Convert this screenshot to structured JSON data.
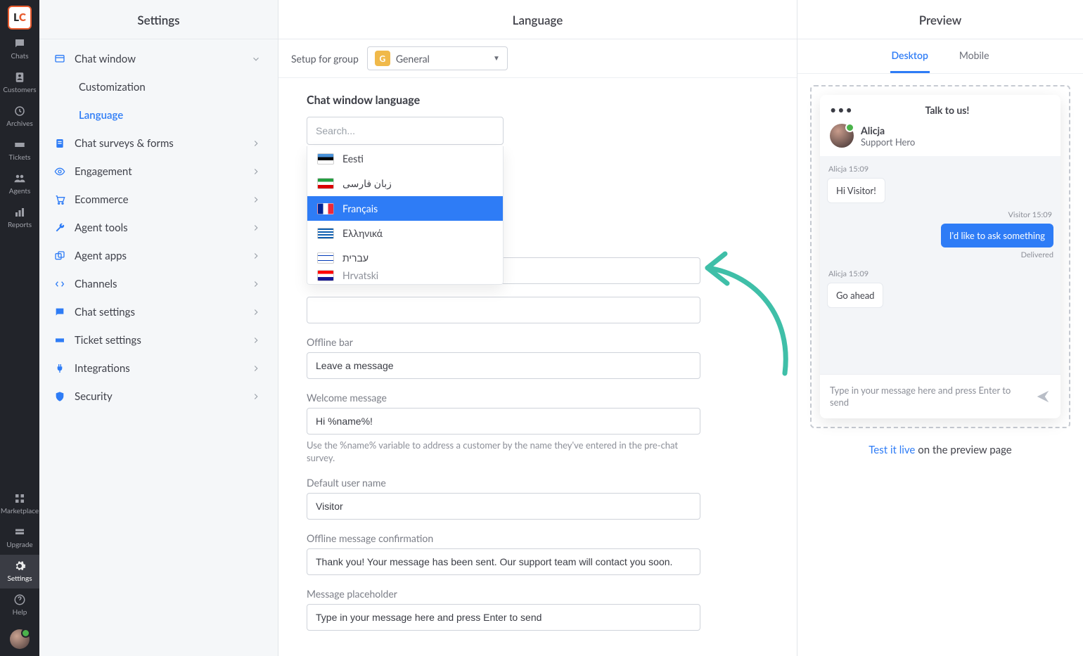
{
  "rail": {
    "items": [
      {
        "label": "Chats"
      },
      {
        "label": "Customers"
      },
      {
        "label": "Archives"
      },
      {
        "label": "Tickets"
      },
      {
        "label": "Agents"
      },
      {
        "label": "Reports"
      }
    ],
    "bottom": [
      {
        "label": "Marketplace"
      },
      {
        "label": "Upgrade"
      },
      {
        "label": "Settings"
      },
      {
        "label": "Help"
      }
    ]
  },
  "sidebar": {
    "title": "Settings",
    "chat_window": {
      "label": "Chat window",
      "sub": {
        "customization": "Customization",
        "language": "Language"
      }
    },
    "items": [
      {
        "label": "Chat surveys & forms"
      },
      {
        "label": "Engagement"
      },
      {
        "label": "Ecommerce"
      },
      {
        "label": "Agent tools"
      },
      {
        "label": "Agent apps"
      },
      {
        "label": "Channels"
      },
      {
        "label": "Chat settings"
      },
      {
        "label": "Ticket settings"
      },
      {
        "label": "Integrations"
      },
      {
        "label": "Security"
      }
    ]
  },
  "editor": {
    "title": "Language",
    "group_label": "Setup for group",
    "group_badge": "G",
    "group_value": "General",
    "section_title": "Chat window language",
    "search_placeholder": "Search...",
    "lang_options": [
      {
        "label": "Eesti"
      },
      {
        "label": "زبان فارسی"
      },
      {
        "label": "Français"
      },
      {
        "label": "Ελληνικά"
      },
      {
        "label": "עברית"
      },
      {
        "label": "Hrvatski"
      }
    ],
    "fields": {
      "offline_bar": {
        "label": "Offline bar",
        "value": "Leave a message"
      },
      "welcome": {
        "label": "Welcome message",
        "value": "Hi %name%!",
        "hint": "Use the %name% variable to address a customer by the name they've entered in the pre-chat survey."
      },
      "default_user": {
        "label": "Default user name",
        "value": "Visitor"
      },
      "offline_confirm": {
        "label": "Offline message confirmation",
        "value": "Thank you! Your message has been sent. Our support team will contact you soon."
      },
      "placeholder": {
        "label": "Message placeholder",
        "value": "Type in your message here and press Enter to send"
      }
    }
  },
  "preview": {
    "title": "Preview",
    "tabs": {
      "desktop": "Desktop",
      "mobile": "Mobile"
    },
    "widget": {
      "title": "Talk to us!",
      "agent_name": "Alicja",
      "agent_role": "Support Hero",
      "meta1": "Alicja 15:09",
      "msg1": "Hi Visitor!",
      "meta2": "Visitor 15:09",
      "msg2": "I'd like to ask something",
      "delivered": "Delivered",
      "meta3": "Alicja 15:09",
      "msg3": "Go ahead",
      "input_ph": "Type in your message here and press Enter to send"
    },
    "test_link": "Test it live",
    "test_suffix": " on the preview page"
  }
}
